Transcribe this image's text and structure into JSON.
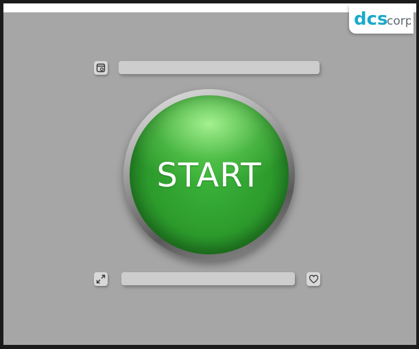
{
  "logo": {
    "brand": "dcs",
    "suffix": "corp",
    "brand_color": "#1aa9c9",
    "suffix_color": "#5b6770"
  },
  "start_button": {
    "label": "START",
    "color": "#2e9e2f"
  },
  "icons": {
    "top_left": "window-settings-icon",
    "bottom_left": "expand-icon",
    "bottom_right": "heart-icon"
  },
  "colors": {
    "background": "#a6a6a6",
    "bar": "#cdcdcd"
  }
}
